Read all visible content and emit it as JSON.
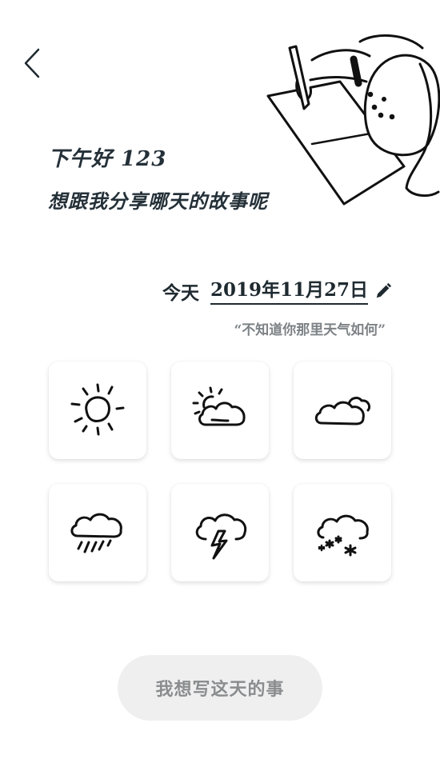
{
  "header": {
    "greeting": "下午好  123",
    "subtitle": "想跟我分享哪天的故事呢"
  },
  "date_picker": {
    "today_label": "今天",
    "date_value": "2019年11月27日",
    "edit_icon": "pencil-icon"
  },
  "weather": {
    "question": "“不知道你那里天气如何”",
    "options": [
      {
        "icon": "sunny-icon"
      },
      {
        "icon": "partly-cloudy-icon"
      },
      {
        "icon": "cloudy-icon"
      },
      {
        "icon": "rain-icon"
      },
      {
        "icon": "thunderstorm-icon"
      },
      {
        "icon": "snow-icon"
      }
    ]
  },
  "actions": {
    "write_button": "我想写这天的事"
  },
  "colors": {
    "text_dark": "#243038",
    "text_muted": "#7d8286",
    "button_bg": "#efefef",
    "button_text": "#8a8d8f"
  }
}
